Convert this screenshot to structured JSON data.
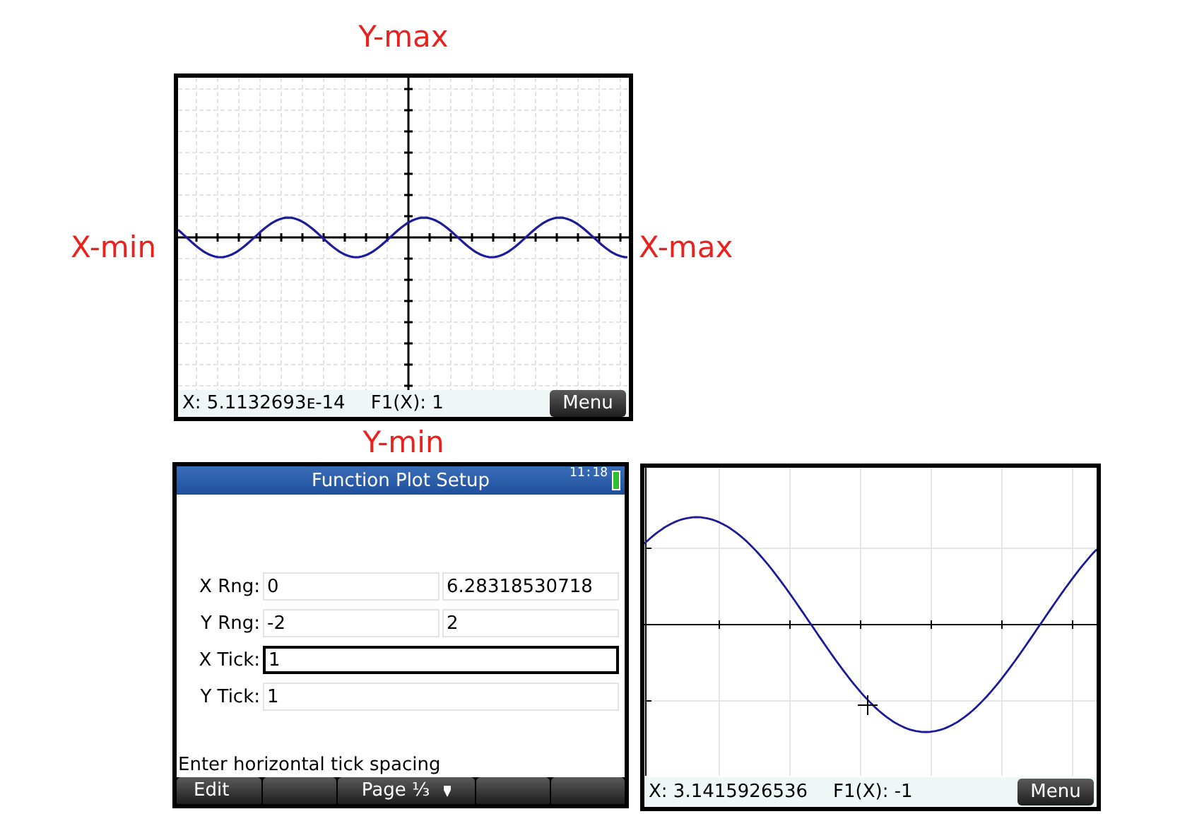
{
  "labels": {
    "y_max": "Y-max",
    "x_min": "X-min",
    "x_max": "X-max",
    "y_min": "Y-min"
  },
  "top_plot_screen": {
    "x_readout": "X: 5.1132693ᴇ-14",
    "f_readout": "F1(X): 1",
    "menu_button": "Menu"
  },
  "setup_screen": {
    "title": "Function Plot Setup",
    "time": "11:18",
    "rows": [
      {
        "label": "X Rng:",
        "fields": [
          {
            "value": "0",
            "selected": false
          },
          {
            "value": "6.28318530718",
            "selected": false
          }
        ]
      },
      {
        "label": "Y Rng:",
        "fields": [
          {
            "value": "-2",
            "selected": false
          },
          {
            "value": "2",
            "selected": false
          }
        ]
      },
      {
        "label": "X Tick:",
        "fields": [
          {
            "value": "1",
            "selected": true
          }
        ]
      },
      {
        "label": "Y Tick:",
        "fields": [
          {
            "value": "1",
            "selected": false
          }
        ]
      }
    ],
    "hint": "Enter horizontal tick spacing",
    "softkeys": [
      {
        "kind": "label",
        "label": "Edit"
      },
      {
        "kind": "blank"
      },
      {
        "kind": "dropdown",
        "label": "Page ⅓"
      },
      {
        "kind": "blank"
      },
      {
        "kind": "blank"
      }
    ]
  },
  "bottom_plot_screen": {
    "x_readout": "X: 3.1415926536",
    "f_readout": "F1(X): -1",
    "menu_button": "Menu"
  }
}
